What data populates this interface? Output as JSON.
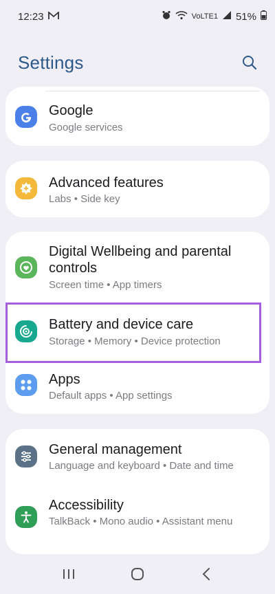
{
  "status_bar": {
    "time": "12:23",
    "network_small": "VoLTE1",
    "battery": "51%"
  },
  "header": {
    "title": "Settings"
  },
  "items": {
    "google": {
      "title": "Google",
      "subtitle": "Google services",
      "icon": "google-icon",
      "color": "#4a80e8"
    },
    "advanced": {
      "title": "Advanced features",
      "subtitle": "Labs  •  Side key",
      "icon": "gear-plus-icon",
      "color": "#f4b93a"
    },
    "wellbeing": {
      "title": "Digital Wellbeing and parental controls",
      "subtitle": "Screen time  •  App timers",
      "icon": "heart-circle-icon",
      "color": "#5bb55b"
    },
    "battery": {
      "title": "Battery and device care",
      "subtitle": "Storage  •  Memory  •  Device protection",
      "icon": "device-care-icon",
      "color": "#17a88f"
    },
    "apps": {
      "title": "Apps",
      "subtitle": "Default apps  •  App settings",
      "icon": "apps-grid-icon",
      "color": "#5e9cf0"
    },
    "general": {
      "title": "General management",
      "subtitle": "Language and keyboard  •  Date and time",
      "icon": "sliders-icon",
      "color": "#5a7188"
    },
    "accessibility": {
      "title": "Accessibility",
      "subtitle": "TalkBack  •  Mono audio  •  Assistant menu",
      "icon": "accessibility-icon",
      "color": "#2f9e56"
    }
  },
  "highlight_color": "#a35fe0"
}
